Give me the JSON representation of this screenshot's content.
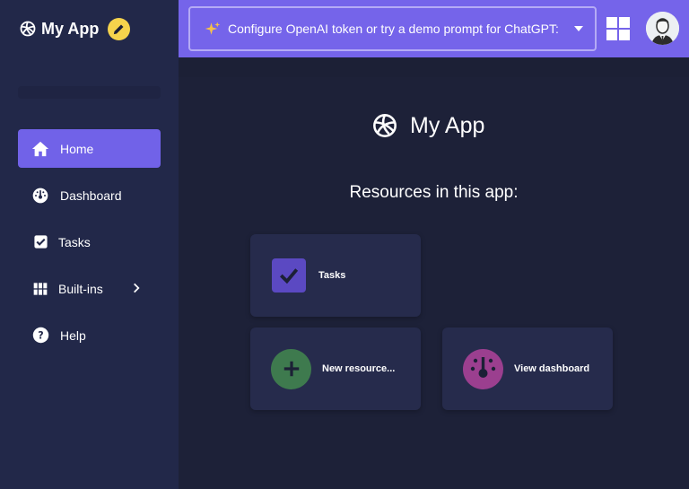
{
  "brand": {
    "name": "My App"
  },
  "sidebar": {
    "items": [
      {
        "label": "Home"
      },
      {
        "label": "Dashboard"
      },
      {
        "label": "Tasks"
      },
      {
        "label": "Built-ins"
      },
      {
        "label": "Help"
      }
    ]
  },
  "header": {
    "prompt_text": "Configure OpenAI token or try a demo prompt for ChatGPT:"
  },
  "main": {
    "app_title": "My App",
    "resources_heading": "Resources in this app:",
    "cards": [
      {
        "label": "Tasks"
      },
      {
        "label": "New resource..."
      },
      {
        "label": "View dashboard"
      }
    ]
  },
  "colors": {
    "accent": "#7162e8",
    "header_bg": "#7564ea",
    "sidebar_bg": "#222849",
    "main_bg": "#1c2036",
    "card_bg": "#262b4c",
    "edit_badge": "#f5d34c",
    "tasks_icon": "#5b49c2",
    "new_resource_icon": "#3e7a4e",
    "dashboard_icon": "#9b3f8f"
  },
  "icons": {
    "brand": "volleyball-icon",
    "edit": "pencil-icon",
    "home": "home-icon",
    "dashboard": "gauge-icon",
    "tasks": "checkbox-icon",
    "builtins": "grid-icon",
    "help": "help-circle-icon",
    "prompt": "sparkles-icon",
    "apps": "windows-grid-icon",
    "avatar": "user-avatar-icon"
  }
}
